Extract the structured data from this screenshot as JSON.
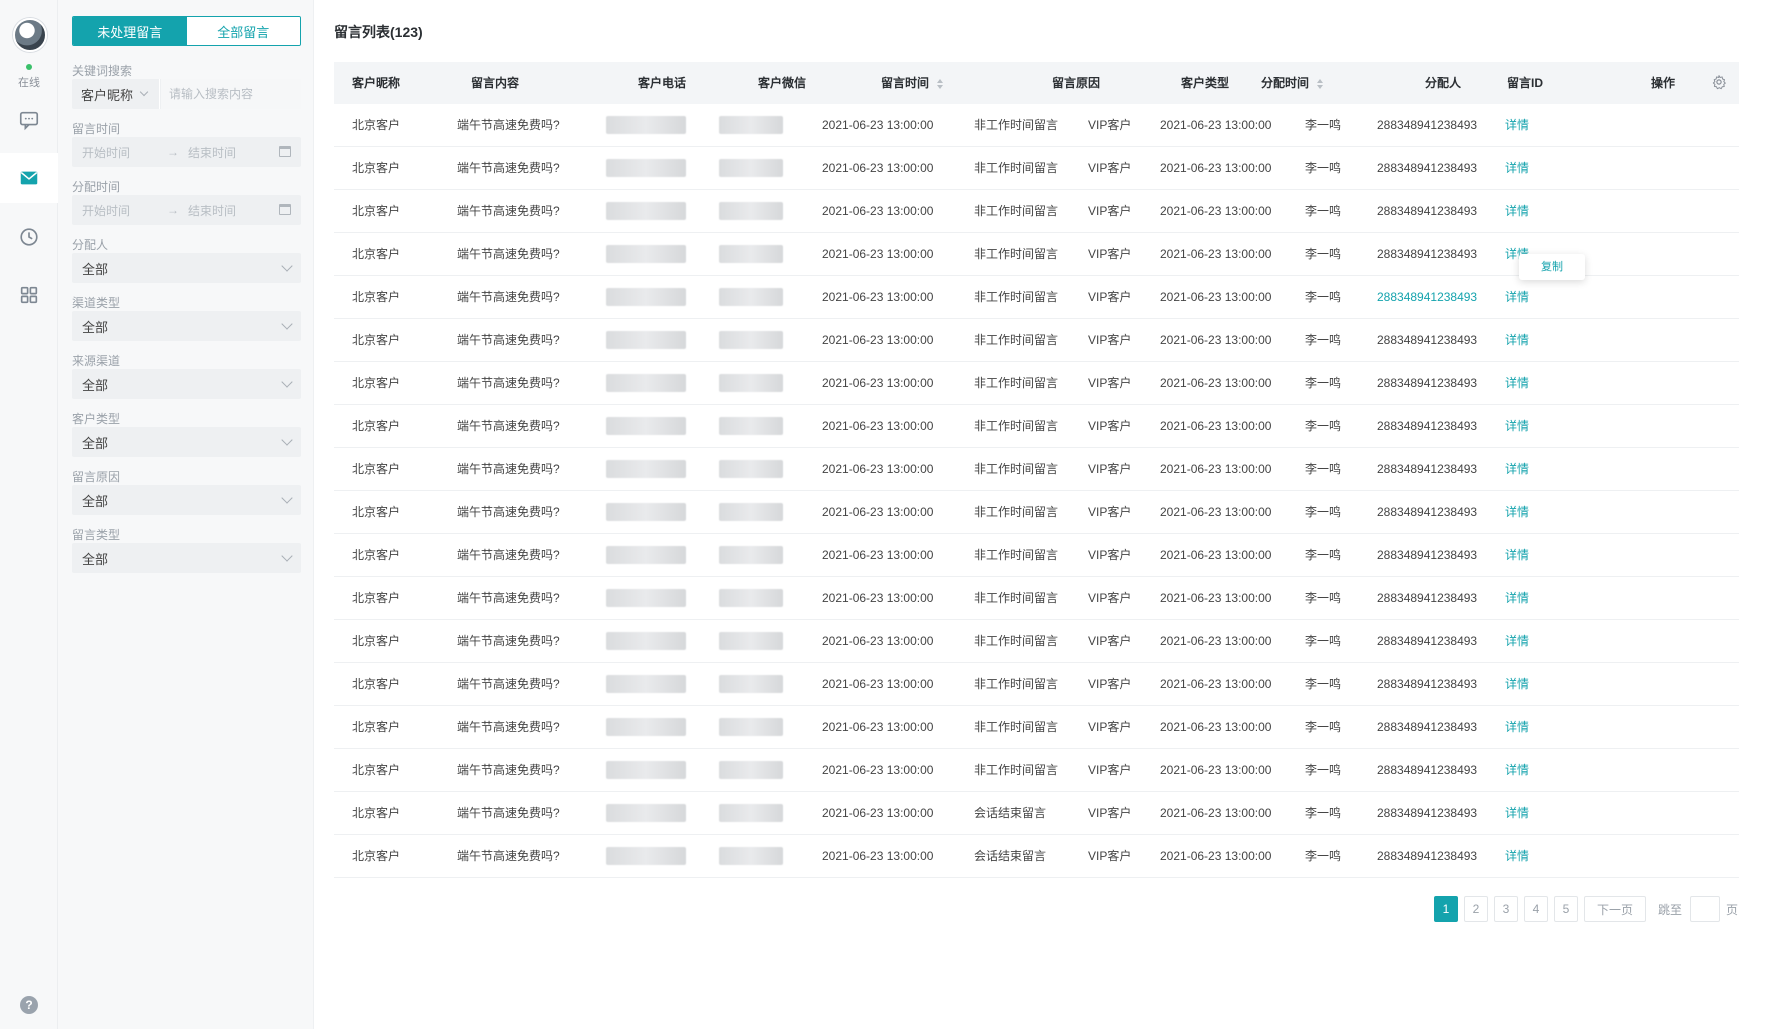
{
  "rail": {
    "status": "在线",
    "items": [
      {
        "icon": "chat-icon",
        "active": false
      },
      {
        "icon": "mail-icon",
        "active": true
      },
      {
        "icon": "clock-icon",
        "active": false
      },
      {
        "icon": "grid-icon",
        "active": false
      }
    ],
    "help": "?"
  },
  "filters": {
    "tabs": [
      {
        "label": "未处理留言",
        "active": true
      },
      {
        "label": "全部留言",
        "active": false
      }
    ],
    "keyword": {
      "label": "关键词搜索",
      "field": "客户昵称",
      "placeholder": "请输入搜索内容"
    },
    "message_time": {
      "label": "留言时间",
      "start": "开始时间",
      "arrow": "→",
      "end": "结束时间"
    },
    "assign_time": {
      "label": "分配时间",
      "start": "开始时间",
      "arrow": "→",
      "end": "结束时间"
    },
    "selects": [
      {
        "label": "分配人",
        "value": "全部"
      },
      {
        "label": "渠道类型",
        "value": "全部"
      },
      {
        "label": "来源渠道",
        "value": "全部"
      },
      {
        "label": "客户类型",
        "value": "全部"
      },
      {
        "label": "留言原因",
        "value": "全部"
      },
      {
        "label": "留言类型",
        "value": "全部"
      }
    ]
  },
  "main": {
    "title": "留言列表(123)",
    "columns": [
      "客户昵称",
      "留言内容",
      "客户电话",
      "客户微信",
      "留言时间",
      "留言原因",
      "客户类型",
      "分配时间",
      "分配人",
      "留言ID",
      "操作"
    ],
    "tooltip": "复制",
    "rows": [
      {
        "nickname": "北京客户",
        "content": "端午节高速免费吗?",
        "msg_time": "2021-06-23 13:00:00",
        "reason": "非工作时间留言",
        "ctype": "VIP客户",
        "assign_time": "2021-06-23 13:00:00",
        "assignee": "李一鸣",
        "id": "288348941238493",
        "action": "详情"
      },
      {
        "nickname": "北京客户",
        "content": "端午节高速免费吗?",
        "msg_time": "2021-06-23 13:00:00",
        "reason": "非工作时间留言",
        "ctype": "VIP客户",
        "assign_time": "2021-06-23 13:00:00",
        "assignee": "李一鸣",
        "id": "288348941238493",
        "action": "详情"
      },
      {
        "nickname": "北京客户",
        "content": "端午节高速免费吗?",
        "msg_time": "2021-06-23 13:00:00",
        "reason": "非工作时间留言",
        "ctype": "VIP客户",
        "assign_time": "2021-06-23 13:00:00",
        "assignee": "李一鸣",
        "id": "288348941238493",
        "action": "详情"
      },
      {
        "nickname": "北京客户",
        "content": "端午节高速免费吗?",
        "msg_time": "2021-06-23 13:00:00",
        "reason": "非工作时间留言",
        "ctype": "VIP客户",
        "assign_time": "2021-06-23 13:00:00",
        "assignee": "李一鸣",
        "id": "288348941238493",
        "action": "详情"
      },
      {
        "nickname": "北京客户",
        "content": "端午节高速免费吗?",
        "msg_time": "2021-06-23 13:00:00",
        "reason": "非工作时间留言",
        "ctype": "VIP客户",
        "assign_time": "2021-06-23 13:00:00",
        "assignee": "李一鸣",
        "id": "288348941238493",
        "action": "详情",
        "highlight": true
      },
      {
        "nickname": "北京客户",
        "content": "端午节高速免费吗?",
        "msg_time": "2021-06-23 13:00:00",
        "reason": "非工作时间留言",
        "ctype": "VIP客户",
        "assign_time": "2021-06-23 13:00:00",
        "assignee": "李一鸣",
        "id": "288348941238493",
        "action": "详情"
      },
      {
        "nickname": "北京客户",
        "content": "端午节高速免费吗?",
        "msg_time": "2021-06-23 13:00:00",
        "reason": "非工作时间留言",
        "ctype": "VIP客户",
        "assign_time": "2021-06-23 13:00:00",
        "assignee": "李一鸣",
        "id": "288348941238493",
        "action": "详情"
      },
      {
        "nickname": "北京客户",
        "content": "端午节高速免费吗?",
        "msg_time": "2021-06-23 13:00:00",
        "reason": "非工作时间留言",
        "ctype": "VIP客户",
        "assign_time": "2021-06-23 13:00:00",
        "assignee": "李一鸣",
        "id": "288348941238493",
        "action": "详情"
      },
      {
        "nickname": "北京客户",
        "content": "端午节高速免费吗?",
        "msg_time": "2021-06-23 13:00:00",
        "reason": "非工作时间留言",
        "ctype": "VIP客户",
        "assign_time": "2021-06-23 13:00:00",
        "assignee": "李一鸣",
        "id": "288348941238493",
        "action": "详情"
      },
      {
        "nickname": "北京客户",
        "content": "端午节高速免费吗?",
        "msg_time": "2021-06-23 13:00:00",
        "reason": "非工作时间留言",
        "ctype": "VIP客户",
        "assign_time": "2021-06-23 13:00:00",
        "assignee": "李一鸣",
        "id": "288348941238493",
        "action": "详情"
      },
      {
        "nickname": "北京客户",
        "content": "端午节高速免费吗?",
        "msg_time": "2021-06-23 13:00:00",
        "reason": "非工作时间留言",
        "ctype": "VIP客户",
        "assign_time": "2021-06-23 13:00:00",
        "assignee": "李一鸣",
        "id": "288348941238493",
        "action": "详情"
      },
      {
        "nickname": "北京客户",
        "content": "端午节高速免费吗?",
        "msg_time": "2021-06-23 13:00:00",
        "reason": "非工作时间留言",
        "ctype": "VIP客户",
        "assign_time": "2021-06-23 13:00:00",
        "assignee": "李一鸣",
        "id": "288348941238493",
        "action": "详情"
      },
      {
        "nickname": "北京客户",
        "content": "端午节高速免费吗?",
        "msg_time": "2021-06-23 13:00:00",
        "reason": "非工作时间留言",
        "ctype": "VIP客户",
        "assign_time": "2021-06-23 13:00:00",
        "assignee": "李一鸣",
        "id": "288348941238493",
        "action": "详情"
      },
      {
        "nickname": "北京客户",
        "content": "端午节高速免费吗?",
        "msg_time": "2021-06-23 13:00:00",
        "reason": "非工作时间留言",
        "ctype": "VIP客户",
        "assign_time": "2021-06-23 13:00:00",
        "assignee": "李一鸣",
        "id": "288348941238493",
        "action": "详情"
      },
      {
        "nickname": "北京客户",
        "content": "端午节高速免费吗?",
        "msg_time": "2021-06-23 13:00:00",
        "reason": "非工作时间留言",
        "ctype": "VIP客户",
        "assign_time": "2021-06-23 13:00:00",
        "assignee": "李一鸣",
        "id": "288348941238493",
        "action": "详情"
      },
      {
        "nickname": "北京客户",
        "content": "端午节高速免费吗?",
        "msg_time": "2021-06-23 13:00:00",
        "reason": "非工作时间留言",
        "ctype": "VIP客户",
        "assign_time": "2021-06-23 13:00:00",
        "assignee": "李一鸣",
        "id": "288348941238493",
        "action": "详情"
      },
      {
        "nickname": "北京客户",
        "content": "端午节高速免费吗?",
        "msg_time": "2021-06-23 13:00:00",
        "reason": "会话结束留言",
        "ctype": "VIP客户",
        "assign_time": "2021-06-23 13:00:00",
        "assignee": "李一鸣",
        "id": "288348941238493",
        "action": "详情"
      },
      {
        "nickname": "北京客户",
        "content": "端午节高速免费吗?",
        "msg_time": "2021-06-23 13:00:00",
        "reason": "会话结束留言",
        "ctype": "VIP客户",
        "assign_time": "2021-06-23 13:00:00",
        "assignee": "李一鸣",
        "id": "288348941238493",
        "action": "详情"
      }
    ]
  },
  "pagination": {
    "pages": [
      "1",
      "2",
      "3",
      "4",
      "5"
    ],
    "current": "1",
    "next": "下一页",
    "jump_label": "跳至",
    "jump_value": "",
    "suffix": "页"
  },
  "colors": {
    "accent": "#14a3ad",
    "panel": "#f7f8f9",
    "header": "#f3f5f7"
  }
}
